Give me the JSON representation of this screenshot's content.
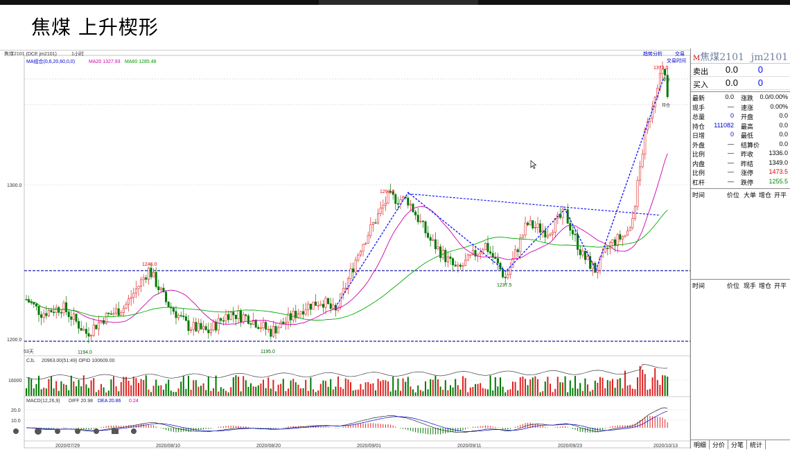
{
  "title": "焦煤 上升楔形",
  "chart_header": {
    "symbol_info": "焦煤2101 (DCE jm2101)",
    "period": "1小时",
    "ma_line_label": "MA组合(0,6,20,60,0,0)",
    "ma20_text": "MA20 1327.93",
    "ma60_text": "MA60 1285.48",
    "vol_line": "20963.00(51:49) OPID 100609.00",
    "vol_name": "CJL",
    "macd_name": "MACD(12,26,9)",
    "diff_text": "DIFF 20.98",
    "dea_text": "DEA 20.86",
    "macd_value": "0.24",
    "top_right_tool": "趋势分析",
    "top_right_tool2": "交易时间",
    "top_right_btn": "交易"
  },
  "chart_data": {
    "type": "candlestick",
    "y_ticks": [
      {
        "value": 1300,
        "label": "1300.0"
      },
      {
        "value": 1200,
        "label": "1200.0"
      }
    ],
    "y_range": [
      1188,
      1400
    ],
    "annotations": [
      {
        "label": "1373.0",
        "value": 1373.0
      },
      {
        "label": "1293.0",
        "value": 1293.0
      },
      {
        "label": "1246.0",
        "value": 1246.0
      },
      {
        "label": "1237.5",
        "value": 1237.5
      },
      {
        "label": "1194.0",
        "value": 1194.0
      },
      {
        "label": "1195.0",
        "value": 1195.0
      }
    ],
    "price_tags": [
      "持仓",
      "持仓"
    ],
    "x_labels": [
      "2020/07/29",
      "2020/08/10",
      "2020/08/20",
      "2020/09/01",
      "2020/09/11",
      "2020/09/23",
      "2020/10/13"
    ],
    "vol_axis": {
      "label": "16000"
    },
    "macd_axis": [
      {
        "label": "20.0"
      },
      {
        "label": "10.0"
      }
    ],
    "lower_left_label": "53天",
    "ma_colors": {
      "ma20": "#cc00aa",
      "ma60": "#00aa00",
      "up": "#dd2222",
      "down": "#007700"
    }
  },
  "right_panel": {
    "name": "焦煤2101",
    "code": "jm2101",
    "sell": {
      "label": "卖出",
      "price": "0.0",
      "qty": "0"
    },
    "buy": {
      "label": "买入",
      "price": "0.0",
      "qty": "0"
    },
    "quote": [
      [
        "最新",
        "0.0",
        "涨跌",
        "0.0/0.00%"
      ],
      [
        "现手",
        "—",
        "速涨",
        "0.00%"
      ],
      [
        "总量",
        "0",
        "开盘",
        "0.0"
      ],
      [
        "持仓",
        "111082",
        "最高",
        "0.0"
      ],
      [
        "日增",
        "0",
        "最低",
        "0.0"
      ],
      [
        "外盘",
        "—",
        "结算价",
        "0.0"
      ],
      [
        "比例",
        "—",
        "昨收",
        "1336.0"
      ],
      [
        "内盘",
        "—",
        "昨结",
        "1349.0"
      ],
      [
        "比例",
        "—",
        "涨停",
        "1473.5"
      ],
      [
        "杠杆",
        "—",
        "跌停",
        "1255.5"
      ]
    ],
    "grid1": [
      "时间",
      "价位",
      "大单",
      "增仓",
      "开平"
    ],
    "grid2": [
      "时间",
      "价位",
      "现手",
      "增仓",
      "开平"
    ],
    "tabs": [
      "明细",
      "分价",
      "分笔",
      "统计"
    ]
  }
}
